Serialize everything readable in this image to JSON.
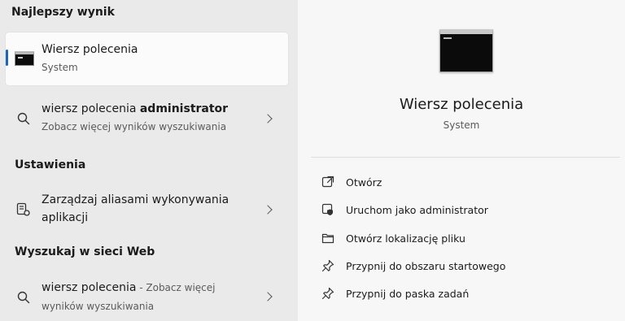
{
  "left": {
    "best_match_title": "Najlepszy wynik",
    "best": {
      "title": "Wiersz polecenia",
      "subtitle": "System",
      "icon": "command-prompt-icon"
    },
    "admin": {
      "title_prefix": "wiersz polecenia ",
      "title_bold": "administrator",
      "subtitle": "Zobacz więcej wyników wyszukiwania",
      "icon": "search-icon"
    },
    "settings_title": "Ustawienia",
    "settings_item": {
      "line1": "Zarządzaj aliasami wykonywania",
      "line2": "aplikacji",
      "icon": "app-alias-settings-icon"
    },
    "web_title": "Wyszukaj w sieci Web",
    "web_item": {
      "title": "wiersz polecenia",
      "suffix": " - Zobacz więcej",
      "line2": "wyników wyszukiwania",
      "icon": "search-icon"
    }
  },
  "right": {
    "app_title": "Wiersz polecenia",
    "app_subtitle": "System",
    "actions": [
      {
        "label": "Otwórz",
        "icon": "open-icon"
      },
      {
        "label": "Uruchom jako administrator",
        "icon": "shield-icon"
      },
      {
        "label": "Otwórz lokalizację pliku",
        "icon": "folder-icon"
      },
      {
        "label": "Przypnij do obszaru startowego",
        "icon": "pin-icon"
      },
      {
        "label": "Przypnij do paska zadań",
        "icon": "pin-icon"
      }
    ]
  },
  "colors": {
    "accent": "#1766c4",
    "left_bg": "#eaeaea",
    "right_bg": "#f7f7f7"
  }
}
